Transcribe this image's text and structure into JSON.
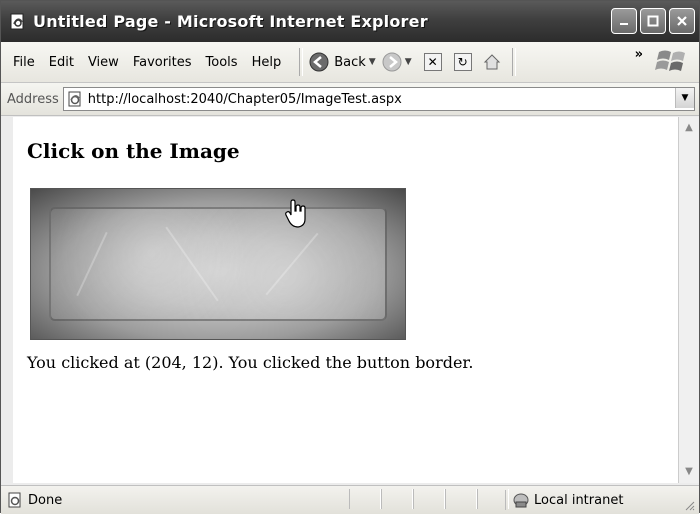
{
  "window": {
    "title": "Untitled Page - Microsoft Internet Explorer"
  },
  "menu": {
    "items": [
      "File",
      "Edit",
      "View",
      "Favorites",
      "Tools",
      "Help"
    ]
  },
  "toolbar": {
    "back_label": "Back",
    "more_label": "»"
  },
  "address": {
    "label": "Address",
    "url": "http://localhost:2040/Chapter05/ImageTest.aspx"
  },
  "page": {
    "heading": "Click on the Image",
    "result": "You clicked at (204, 12). You clicked the button border."
  },
  "status": {
    "text": "Done",
    "zone": "Local intranet"
  },
  "icons": {
    "app": "ie-page-icon",
    "back": "back-arrow-icon",
    "forward": "forward-arrow-icon",
    "stop": "stop-icon",
    "refresh": "refresh-icon",
    "home": "home-icon",
    "logo": "windows-logo-icon"
  },
  "colors": {
    "titlebar": "#3f3f3f",
    "chrome": "#ececec",
    "content": "#ffffff"
  }
}
